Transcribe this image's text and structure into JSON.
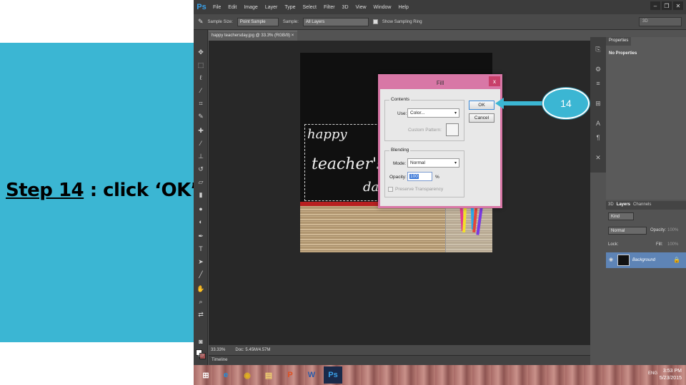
{
  "slide": {
    "step_label": "Step 14",
    "step_rest": " : click ‘OK’",
    "callout_number": "14",
    "accent_color": "#3bb6d3"
  },
  "photoshop": {
    "logo": "Ps",
    "menu": [
      "File",
      "Edit",
      "Image",
      "Layer",
      "Type",
      "Select",
      "Filter",
      "3D",
      "View",
      "Window",
      "Help"
    ],
    "window_controls": [
      "–",
      "❐",
      "✕"
    ],
    "options": {
      "sample_size_label": "Sample Size:",
      "sample_size_value": "Point Sample",
      "sample_label": "Sample:",
      "sample_value": "All Layers",
      "show_ring_label": "Show Sampling Ring",
      "workspace_value": "3D"
    },
    "document_tab": "happy teachersday.jpg @ 33.3% (RGB/8)",
    "document_tab_close": "×",
    "image_text": [
      "happy",
      "teacher's",
      "day!"
    ],
    "status": {
      "zoom": "33.33%",
      "doc": "Doc: 5.45M/4.57M"
    },
    "timeline_label": "Timeline",
    "properties": {
      "tab": "Properties",
      "empty": "No Properties"
    },
    "layers": {
      "tabs": [
        "3D",
        "Layers",
        "Channels"
      ],
      "kind_label": "Kind",
      "blend_mode": "Normal",
      "opacity_label": "Opacity:",
      "opacity_value": "100%",
      "lock_label": "Lock:",
      "fill_label": "Fill:",
      "fill_value": "100%",
      "layer_name": "Background"
    }
  },
  "fill_dialog": {
    "title": "Fill",
    "close": "x",
    "contents_group": "Contents",
    "use_label": "Use:",
    "use_value": "Color...",
    "custom_pattern_label": "Custom Pattern:",
    "blending_group": "Blending",
    "mode_label": "Mode:",
    "mode_value": "Normal",
    "opacity_label": "Opacity:",
    "opacity_value": "100",
    "opacity_unit": "%",
    "preserve_label": "Preserve Transparency",
    "ok_label": "OK",
    "cancel_label": "Cancel"
  },
  "taskbar": {
    "time": "3:53 PM",
    "date": "5/23/2015",
    "lang": "ENG"
  }
}
